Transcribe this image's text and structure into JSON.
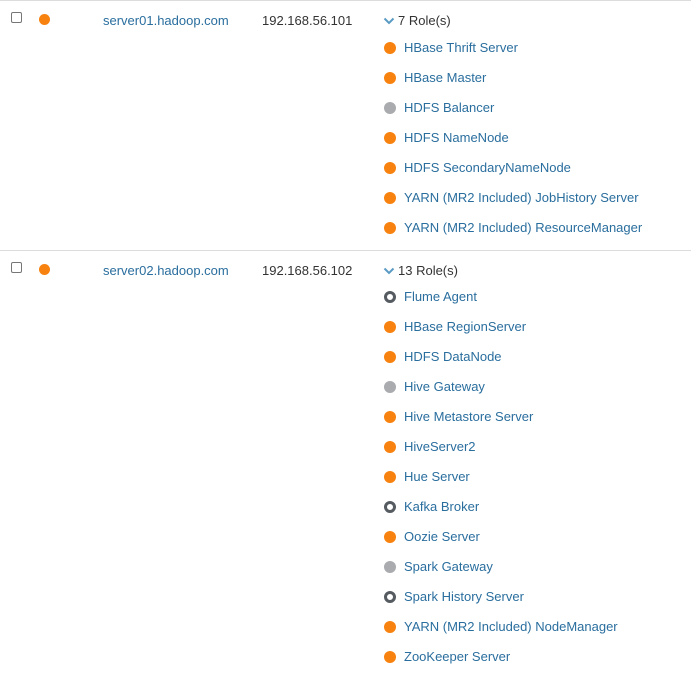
{
  "colors": {
    "good": "#f7820f",
    "not_applicable": "#a9abae",
    "stopped": "#555b61",
    "link": "#2a6e9e"
  },
  "hosts": [
    {
      "hostname": "server01.hadoop.com",
      "ip": "192.168.56.101",
      "health": "good",
      "roles_label": "7 Role(s)",
      "roles": [
        {
          "name": "HBase Thrift Server",
          "status": "good"
        },
        {
          "name": "HBase Master",
          "status": "good"
        },
        {
          "name": "HDFS Balancer",
          "status": "na"
        },
        {
          "name": "HDFS NameNode",
          "status": "good"
        },
        {
          "name": "HDFS SecondaryNameNode",
          "status": "good"
        },
        {
          "name": "YARN (MR2 Included) JobHistory Server",
          "status": "good"
        },
        {
          "name": "YARN (MR2 Included) ResourceManager",
          "status": "good"
        }
      ]
    },
    {
      "hostname": "server02.hadoop.com",
      "ip": "192.168.56.102",
      "health": "good",
      "roles_label": "13 Role(s)",
      "roles": [
        {
          "name": "Flume Agent",
          "status": "stopped"
        },
        {
          "name": "HBase RegionServer",
          "status": "good"
        },
        {
          "name": "HDFS DataNode",
          "status": "good"
        },
        {
          "name": "Hive Gateway",
          "status": "na"
        },
        {
          "name": "Hive Metastore Server",
          "status": "good"
        },
        {
          "name": "HiveServer2",
          "status": "good"
        },
        {
          "name": "Hue Server",
          "status": "good"
        },
        {
          "name": "Kafka Broker",
          "status": "stopped"
        },
        {
          "name": "Oozie Server",
          "status": "good"
        },
        {
          "name": "Spark Gateway",
          "status": "na"
        },
        {
          "name": "Spark History Server",
          "status": "stopped"
        },
        {
          "name": "YARN (MR2 Included) NodeManager",
          "status": "good"
        },
        {
          "name": "ZooKeeper Server",
          "status": "good"
        }
      ]
    }
  ]
}
